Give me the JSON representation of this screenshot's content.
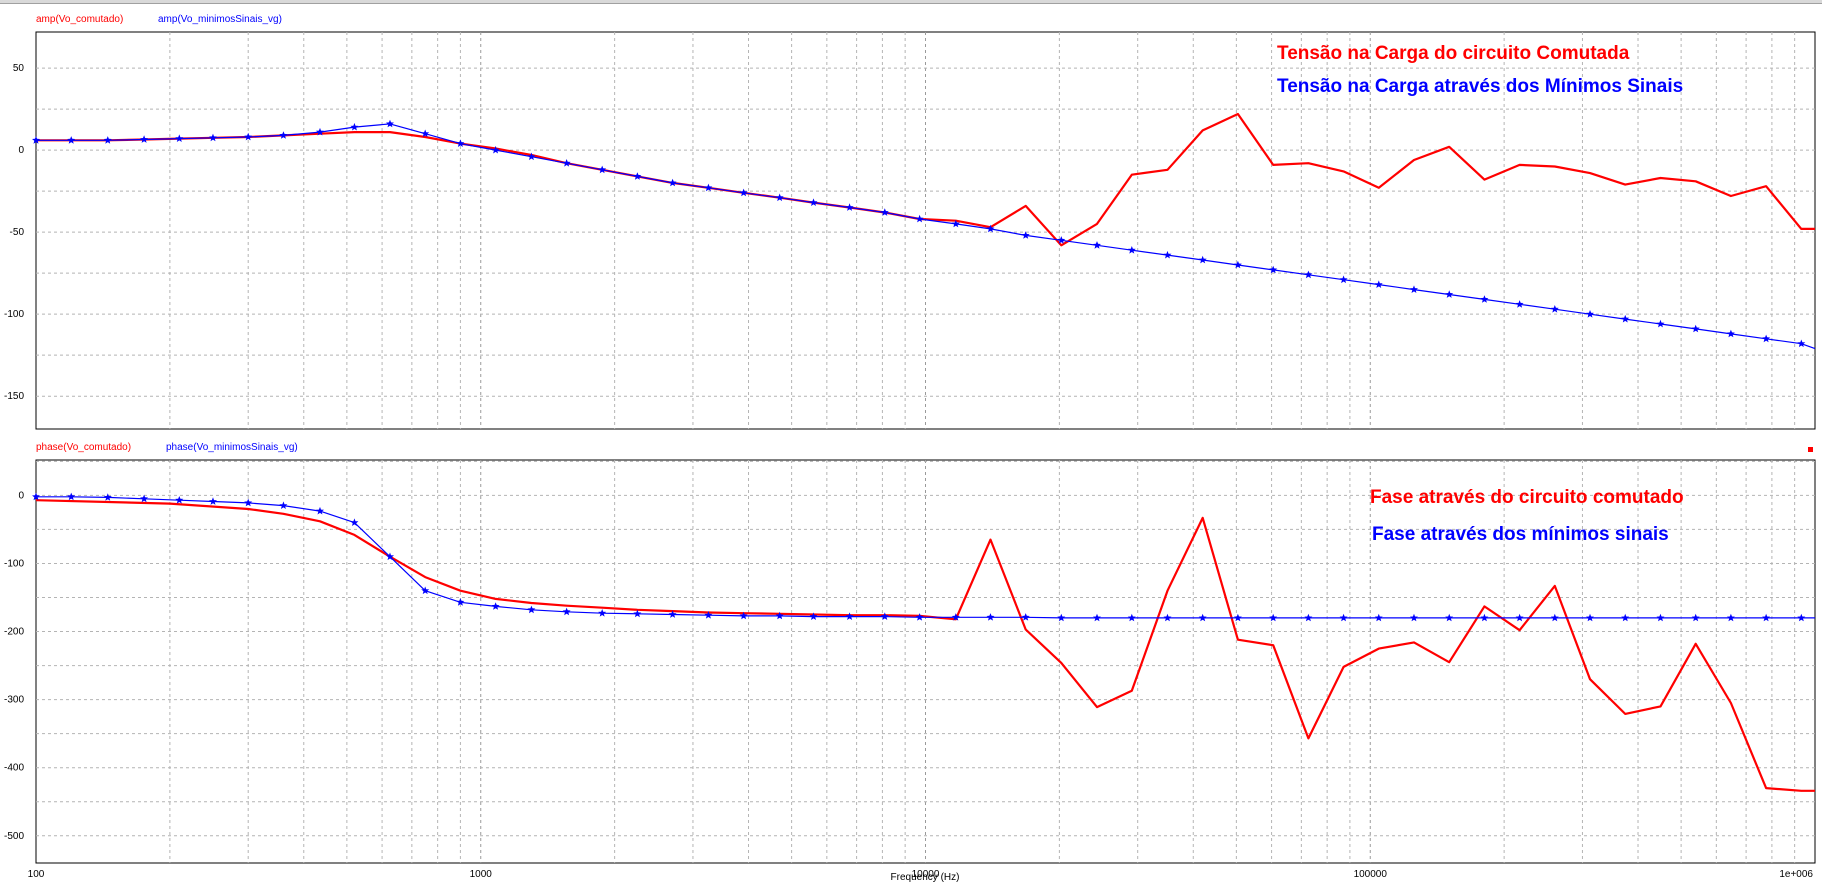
{
  "chart_data": [
    {
      "type": "line",
      "x_scale": "log",
      "xlim": [
        100,
        1000000
      ],
      "ylim": [
        -170,
        72
      ],
      "yticks": [
        50,
        0,
        -50,
        -100,
        -150
      ],
      "legend": [
        "amp(Vo_comutado)",
        "amp(Vo_minimosSinais_vg)"
      ],
      "annotations": [
        "Tensão na Carga do circuito Comutada",
        "Tensão na Carga através dos Mínimos Sinais"
      ],
      "series": [
        {
          "name": "amp(Vo_comutado)",
          "color": "#ff0000",
          "x": [
            100,
            120,
            145,
            175,
            210,
            250,
            300,
            360,
            435,
            520,
            625,
            750,
            900,
            1080,
            1300,
            1560,
            1875,
            2250,
            2700,
            3250,
            3900,
            4700,
            5600,
            6750,
            8100,
            9700,
            11700,
            14000,
            16800,
            20200,
            24300,
            29100,
            35000,
            42000,
            50400,
            60500,
            72600,
            87100,
            104500,
            125400,
            150500,
            180600,
            216700,
            260000,
            312000,
            374400,
            449300,
            539200,
            647000,
            776400,
            931700,
            1000000
          ],
          "y": [
            6,
            6,
            6,
            6.5,
            7,
            7.5,
            8,
            9,
            10,
            11,
            11,
            8,
            4,
            1,
            -3,
            -8,
            -12,
            -16,
            -20,
            -23,
            -26,
            -29,
            -32,
            -35,
            -38,
            -42,
            -43,
            -47,
            -34,
            -58,
            -45,
            -15,
            -12,
            12,
            22,
            -9,
            -8,
            -13,
            -23,
            -6,
            2,
            -18,
            -9,
            -10,
            -14,
            -21,
            -17,
            -19,
            -28,
            -22,
            -48,
            -48
          ]
        },
        {
          "name": "amp(Vo_minimosSinais_vg)",
          "color": "#0000ff",
          "x": [
            100,
            120,
            145,
            175,
            210,
            250,
            300,
            360,
            435,
            520,
            625,
            750,
            900,
            1080,
            1300,
            1560,
            1875,
            2250,
            2700,
            3250,
            3900,
            4700,
            5600,
            6750,
            8100,
            9700,
            11700,
            14000,
            16800,
            20200,
            24300,
            29100,
            35000,
            42000,
            50400,
            60500,
            72600,
            87100,
            104500,
            125400,
            150500,
            180600,
            216700,
            260000,
            312000,
            374400,
            449300,
            539200,
            647000,
            776400,
            931700,
            1000000
          ],
          "y": [
            6,
            6,
            6,
            6.5,
            7,
            7.5,
            8,
            9,
            11,
            14,
            16,
            10,
            4,
            0,
            -4,
            -8,
            -12,
            -16,
            -20,
            -23,
            -26,
            -29,
            -32,
            -35,
            -38,
            -42,
            -45,
            -48,
            -52,
            -55,
            -58,
            -61,
            -64,
            -67,
            -70,
            -73,
            -76,
            -79,
            -82,
            -85,
            -88,
            -91,
            -94,
            -97,
            -100,
            -103,
            -106,
            -109,
            -112,
            -115,
            -118,
            -121
          ]
        }
      ]
    },
    {
      "type": "line",
      "x_scale": "log",
      "xlim": [
        100,
        1000000
      ],
      "ylim": [
        -540,
        52
      ],
      "yticks": [
        0,
        -100,
        -200,
        -300,
        -400,
        -500
      ],
      "xticks": [
        "100",
        "1000",
        "10000",
        "100000",
        "1e+006"
      ],
      "xlabel": "Frequency (Hz)",
      "legend": [
        "phase(Vo_comutado)",
        "phase(Vo_minimosSinais_vg)"
      ],
      "annotations": [
        "Fase através do circuito comutado",
        "Fase através dos mínimos sinais"
      ],
      "series": [
        {
          "name": "phase(Vo_comutado)",
          "color": "#ff0000",
          "x": [
            100,
            200,
            300,
            360,
            435,
            520,
            625,
            750,
            900,
            1080,
            1300,
            1560,
            1875,
            2250,
            2700,
            3250,
            3900,
            4700,
            5600,
            6750,
            8100,
            9700,
            11700,
            14000,
            16800,
            20200,
            24300,
            29100,
            35000,
            42000,
            50400,
            60500,
            72600,
            87100,
            104500,
            125400,
            150500,
            180600,
            216700,
            260000,
            312000,
            374400,
            449300,
            539200,
            647000,
            776400,
            931700,
            1000000
          ],
          "y": [
            -7,
            -12,
            -20,
            -27,
            -38,
            -58,
            -90,
            -120,
            -140,
            -152,
            -158,
            -162,
            -165,
            -168,
            -170,
            -172,
            -173,
            -174,
            -175,
            -176,
            -176,
            -177,
            -182,
            -65,
            -197,
            -246,
            -311,
            -287,
            -140,
            -33,
            -212,
            -220,
            -357,
            -252,
            -225,
            -216,
            -245,
            -163,
            -198,
            -133,
            -270,
            -321,
            -310,
            -218,
            -305,
            -430,
            -434,
            -434
          ]
        },
        {
          "name": "phase(Vo_minimosSinais_vg)",
          "color": "#0000ff",
          "x": [
            100,
            120,
            145,
            175,
            210,
            250,
            300,
            360,
            435,
            520,
            625,
            750,
            900,
            1080,
            1300,
            1560,
            1875,
            2250,
            2700,
            3250,
            3900,
            4700,
            5600,
            6750,
            8100,
            9700,
            11700,
            14000,
            16800,
            20200,
            24300,
            29100,
            35000,
            42000,
            50400,
            60500,
            72600,
            87100,
            104500,
            125400,
            150500,
            180600,
            216700,
            260000,
            312000,
            374400,
            449300,
            539200,
            647000,
            776400,
            931700,
            1000000
          ],
          "y": [
            -2,
            -2,
            -3,
            -5,
            -7,
            -9,
            -11,
            -15,
            -23,
            -40,
            -90,
            -140,
            -157,
            -163,
            -168,
            -171,
            -173,
            -174,
            -175,
            -176,
            -177,
            -177,
            -178,
            -178,
            -178,
            -179,
            -179,
            -179,
            -179,
            -180,
            -180,
            -180,
            -180,
            -180,
            -180,
            -180,
            -180,
            -180,
            -180,
            -180,
            -180,
            -180,
            -180,
            -180,
            -180,
            -180,
            -180,
            -180,
            -180,
            -180,
            -180,
            -180
          ]
        }
      ]
    }
  ]
}
